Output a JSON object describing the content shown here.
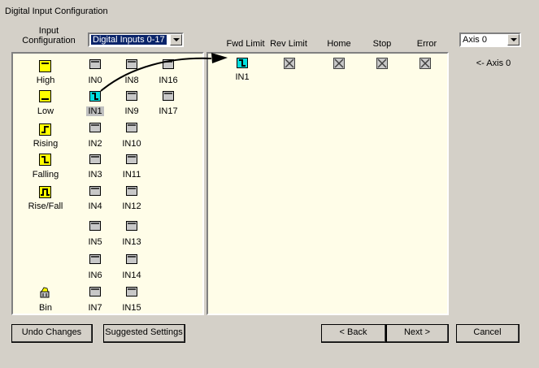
{
  "window": {
    "title": "Digital Input Configuration"
  },
  "input_config": {
    "label": "Input\nConfiguration",
    "label_line1": "Input",
    "label_line2": "Configuration",
    "selected": "Digital Inputs 0-17"
  },
  "axis_select": {
    "selected": "Axis 0"
  },
  "axis_indicator": "<- Axis 0",
  "modes": [
    {
      "label": "High",
      "icon": "high-level-icon"
    },
    {
      "label": "Low",
      "icon": "low-level-icon"
    },
    {
      "label": "Rising",
      "icon": "rising-edge-icon"
    },
    {
      "label": "Falling",
      "icon": "falling-edge-icon"
    },
    {
      "label": "Rise/Fall",
      "icon": "rise-fall-edge-icon"
    }
  ],
  "bin_label": "Bin",
  "inputs_col1": [
    "IN0",
    "IN1",
    "IN2",
    "IN3",
    "IN4",
    "IN5",
    "IN6",
    "IN7"
  ],
  "inputs_col2": [
    "IN8",
    "IN9",
    "IN10",
    "IN11",
    "IN12",
    "IN13",
    "IN14",
    "IN15"
  ],
  "inputs_col3": [
    "IN16",
    "IN17"
  ],
  "assignment_columns": [
    "Fwd Limit",
    "Rev Limit",
    "Home",
    "Stop",
    "Error"
  ],
  "assigned": {
    "fwd_limit": "IN1"
  },
  "buttons": {
    "undo": "Undo Changes",
    "suggested": "Suggested Settings",
    "back": "< Back",
    "next": "Next >",
    "cancel": "Cancel"
  }
}
